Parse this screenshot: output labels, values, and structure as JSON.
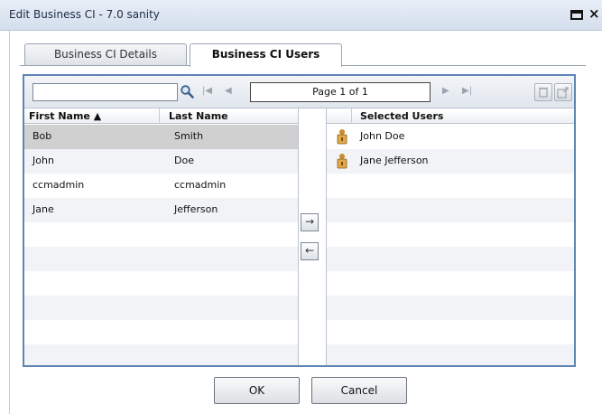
{
  "window": {
    "title": "Edit Business CI - 7.0 sanity",
    "maximize_icon": "maximize-icon",
    "close_label": "×"
  },
  "tabs": [
    {
      "label": "Business CI Details",
      "active": false
    },
    {
      "label": "Business CI Users",
      "active": true
    }
  ],
  "toolbar": {
    "search_value": "",
    "search_placeholder": "",
    "first_page_label": "|◀",
    "prev_page_label": "◀",
    "page_text": "Page 1 of 1",
    "next_page_label": "▶",
    "last_page_label": "▶|"
  },
  "available_users": {
    "headers": {
      "first": "First Name ▲",
      "last": "Last Name"
    },
    "rows": [
      {
        "first": "Bob",
        "last": "Smith"
      },
      {
        "first": "John",
        "last": "Doe"
      },
      {
        "first": "ccmadmin",
        "last": "ccmadmin"
      },
      {
        "first": "Jane",
        "last": "Jefferson"
      }
    ],
    "selected_row": "Bob Smith"
  },
  "move": {
    "add_label": "→",
    "remove_label": "←"
  },
  "selected_users": {
    "header": "Selected Users",
    "rows": [
      {
        "name": "John Doe",
        "icon": "user-lock-icon"
      },
      {
        "name": "Jane Jefferson",
        "icon": "user-lock-icon"
      }
    ]
  },
  "footer": {
    "ok_label": "OK",
    "cancel_label": "Cancel"
  },
  "colors": {
    "panel_border": "#5f85b5",
    "selected_row": "#d0d0d0"
  }
}
